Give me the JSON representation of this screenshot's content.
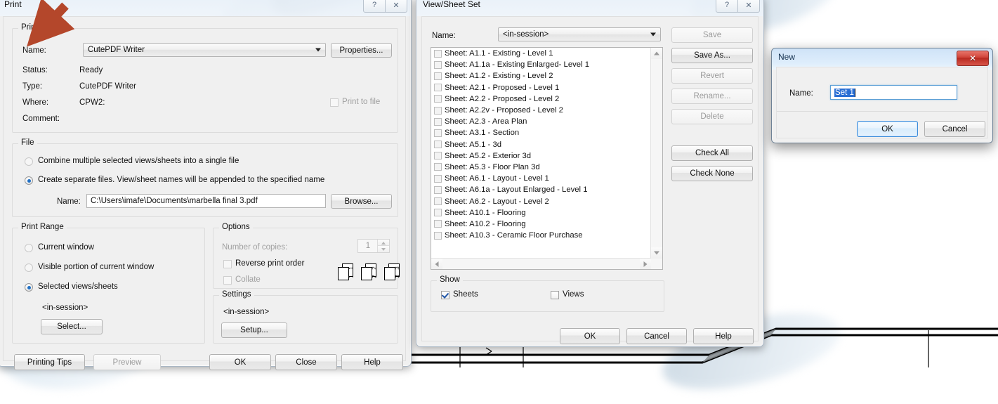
{
  "accent": {
    "arrow": "#b4472b",
    "selection": "#2a6fd4",
    "focus": "#5c9fd6"
  },
  "print_dialog": {
    "title": "Print",
    "titlebar_buttons": [
      {
        "name": "help-icon",
        "glyph": "?"
      },
      {
        "name": "close-icon",
        "glyph": "✕"
      }
    ],
    "printer": {
      "group_label": "Printer",
      "name_label": "Name:",
      "name_value": "CutePDF Writer",
      "properties_label": "Properties...",
      "status_label": "Status:",
      "status_value": "Ready",
      "type_label": "Type:",
      "type_value": "CutePDF Writer",
      "where_label": "Where:",
      "where_value": "CPW2:",
      "comment_label": "Comment:",
      "comment_value": "",
      "print_to_file_label": "Print to file"
    },
    "file": {
      "group_label": "File",
      "option_combine": "Combine multiple selected views/sheets into a single file",
      "option_separate": "Create separate files. View/sheet names will be appended to the specified name",
      "name_label": "Name:",
      "name_value": "C:\\Users\\imafe\\Documents\\marbella final 3.pdf",
      "browse_label": "Browse..."
    },
    "print_range": {
      "group_label": "Print Range",
      "option_current_window": "Current window",
      "option_visible_portion": "Visible portion of current window",
      "option_selected": "Selected views/sheets",
      "selection_value": "<in-session>",
      "select_label": "Select..."
    },
    "options": {
      "group_label": "Options",
      "copies_label": "Number of copies:",
      "copies_value": "1",
      "reverse_label": "Reverse print order",
      "collate_label": "Collate",
      "page_icons": [
        "1",
        "2",
        "3"
      ]
    },
    "settings": {
      "group_label": "Settings",
      "value": "<in-session>",
      "setup_label": "Setup..."
    },
    "footer": {
      "printing_tips": "Printing Tips",
      "preview": "Preview",
      "ok": "OK",
      "close": "Close",
      "help": "Help"
    }
  },
  "viewsheet_dialog": {
    "title": "View/Sheet Set",
    "titlebar_buttons": [
      {
        "name": "help-icon",
        "glyph": "?"
      },
      {
        "name": "close-icon",
        "glyph": "✕"
      }
    ],
    "name_label": "Name:",
    "name_value": "<in-session>",
    "side_buttons": [
      {
        "label": "Save",
        "enabled": false
      },
      {
        "label": "Save As...",
        "enabled": true
      },
      {
        "label": "Revert",
        "enabled": false
      },
      {
        "label": "Rename...",
        "enabled": false
      },
      {
        "label": "Delete",
        "enabled": false
      }
    ],
    "check_all_label": "Check All",
    "check_none_label": "Check None",
    "sheets": [
      "Sheet: A1.1 - Existing - Level 1",
      "Sheet: A1.1a - Existing Enlarged- Level 1",
      "Sheet: A1.2 - Existing - Level 2",
      "Sheet: A2.1 - Proposed - Level 1",
      "Sheet: A2.2 - Proposed - Level 2",
      "Sheet: A2.2v - Proposed - Level 2",
      "Sheet: A2.3 - Area Plan",
      "Sheet: A3.1 - Section",
      "Sheet: A5.1 - 3d",
      "Sheet: A5.2 - Exterior 3d",
      "Sheet: A5.3 - Floor Plan 3d",
      "Sheet: A6.1 - Layout -  Level 1",
      "Sheet: A6.1a - Layout Enlarged - Level 1",
      "Sheet: A6.2 - Layout - Level 2",
      "Sheet: A10.1 - Flooring",
      "Sheet: A10.2 - Flooring",
      "Sheet: A10.3 - Ceramic Floor Purchase"
    ],
    "show": {
      "group_label": "Show",
      "sheets_label": "Sheets",
      "sheets_checked": true,
      "views_label": "Views",
      "views_checked": false
    },
    "footer": {
      "ok": "OK",
      "cancel": "Cancel",
      "help": "Help"
    }
  },
  "new_dialog": {
    "title": "New",
    "close_glyph": "✕",
    "name_label": "Name:",
    "name_value": "Set 1",
    "name_selected": true,
    "ok": "OK",
    "cancel": "Cancel"
  }
}
